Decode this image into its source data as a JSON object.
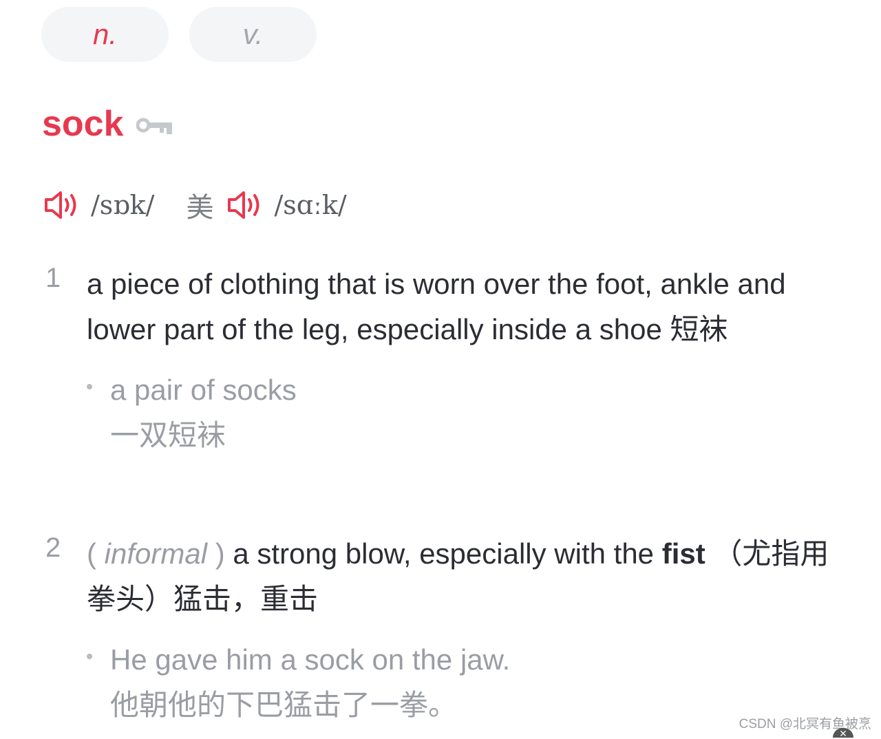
{
  "tabs": [
    {
      "label": "n.",
      "active": true
    },
    {
      "label": "v.",
      "active": false
    }
  ],
  "entry": {
    "headword": "sock",
    "pronunciations": {
      "uk": {
        "phonetic": "/sɒk/"
      },
      "us": {
        "region_label": "美",
        "phonetic": "/sɑːk/"
      }
    }
  },
  "senses": [
    {
      "number": "1",
      "definition_en": "a piece of clothing that is worn over the foot, ankle and lower part of the leg, especially inside a shoe",
      "definition_cn": "短袜",
      "example": {
        "en": "a pair of socks",
        "cn": "一双短袜"
      }
    },
    {
      "number": "2",
      "label_open": "( ",
      "label": "informal",
      "label_close": " )",
      "definition_en_before": "a strong blow, especially with the",
      "definition_bold": "fist",
      "definition_cn": "（尤指用拳头）猛击，重击",
      "example": {
        "en": "He gave him a sock on the jaw.",
        "cn": "他朝他的下巴猛击了一拳。"
      }
    }
  ],
  "watermark": "CSDN @北冥有鱼被烹",
  "colors": {
    "accent": "#e8384f",
    "text": "#2b2d33",
    "muted": "#9a9da3",
    "tab_bg": "#f4f5f7"
  }
}
